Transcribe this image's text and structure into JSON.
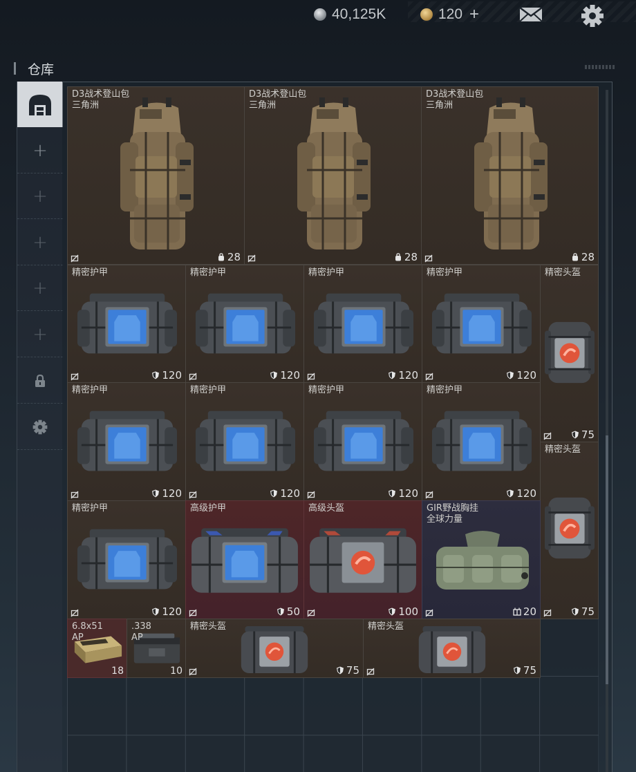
{
  "currency": {
    "silver": "40,125K",
    "gold": "120",
    "gold_add": "+"
  },
  "icons": {
    "mail": "mail-icon",
    "settings": "gear-icon"
  },
  "page_title": "仓库",
  "sidebar": {
    "items": [
      {
        "icon": "warehouse-icon",
        "active": true
      },
      {
        "icon": "plus-icon",
        "label": "+"
      },
      {
        "icon": "plus-icon",
        "label": "+"
      },
      {
        "icon": "plus-icon",
        "label": "+"
      },
      {
        "icon": "plus-icon",
        "label": "+"
      },
      {
        "icon": "plus-icon",
        "label": "+"
      },
      {
        "icon": "lock-icon"
      },
      {
        "icon": "gear-icon"
      }
    ]
  },
  "items": {
    "backpack_1": {
      "name": "D3战术登山包\n三角洲",
      "stat": "28"
    },
    "backpack_2": {
      "name": "D3战术登山包\n三角洲",
      "stat": "28"
    },
    "backpack_3": {
      "name": "D3战术登山包\n三角洲",
      "stat": "28"
    },
    "armor_1": {
      "name": "精密护甲",
      "stat": "120"
    },
    "armor_2": {
      "name": "精密护甲",
      "stat": "120"
    },
    "armor_3": {
      "name": "精密护甲",
      "stat": "120"
    },
    "armor_4": {
      "name": "精密护甲",
      "stat": "120"
    },
    "helmet_1": {
      "name": "精密头盔",
      "stat": "75"
    },
    "armor_5": {
      "name": "精密护甲",
      "stat": "120"
    },
    "armor_6": {
      "name": "精密护甲",
      "stat": "120"
    },
    "armor_7": {
      "name": "精密护甲",
      "stat": "120"
    },
    "armor_8": {
      "name": "精密护甲",
      "stat": "120"
    },
    "helmet_2": {
      "name": "精密头盔",
      "stat": "75"
    },
    "armor_9": {
      "name": "精密护甲",
      "stat": "120"
    },
    "armor_adv": {
      "name": "高级护甲",
      "stat": "50"
    },
    "helmet_adv": {
      "name": "高级头盔",
      "stat": "100"
    },
    "chest_rig": {
      "name": "GIR野战胸挂\n全球力量",
      "stat": "20"
    },
    "ammo_68": {
      "name": "6.8x51\nAP",
      "qty": "18"
    },
    "ammo_338": {
      "name": ".338\nAP",
      "qty": "10"
    },
    "helmet_3": {
      "name": "精密头盔",
      "stat": "75"
    },
    "helmet_4": {
      "name": "精密头盔",
      "stat": "75"
    }
  },
  "colors": {
    "armor_blue": "#3d7fd9",
    "helmet_orange": "#e0553a",
    "rarity_red": "#4e2628",
    "rarity_purple": "#2d2d3e",
    "rarity_brown": "#3a312a"
  }
}
